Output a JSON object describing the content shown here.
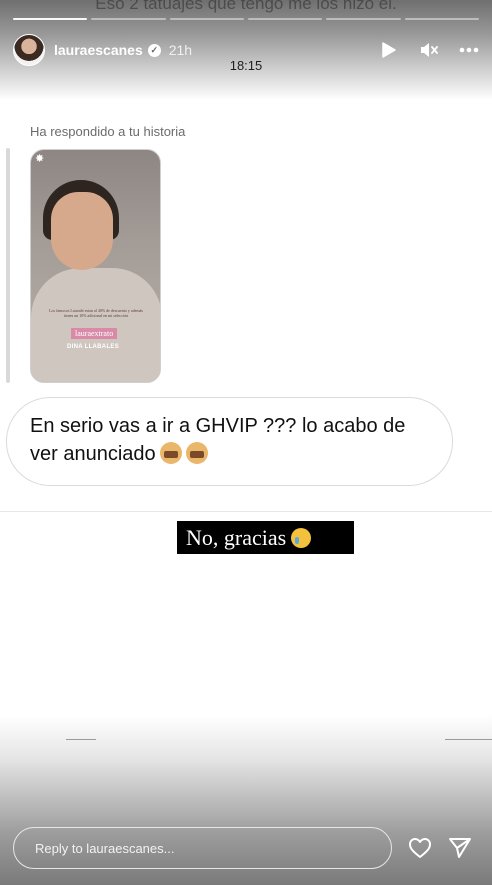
{
  "background": {
    "previous_text": "Eso 2 tatuajes que tengo me los hizo él."
  },
  "progress": {
    "segments": 6,
    "done": 1
  },
  "header": {
    "username": "lauraescanes",
    "time_ago": "21h",
    "verified_icon": "verified-check-icon",
    "clock": "18:15"
  },
  "reply": {
    "label": "Ha respondido a tu historia",
    "thumb_code": "lauraextrato",
    "thumb_brand": "DINA LLABALES",
    "thumb_text": "Los famosos Lauradó estan al 40% de descuento y además tienes un 10% adicional en mi selección",
    "message": "En serio vas a ir a GHVIP ??? lo acabo de ver anunciado"
  },
  "story": {
    "caption": "No, gracias"
  },
  "footer": {
    "reply_placeholder": "Reply to lauraescanes..."
  },
  "icons": {
    "play": "play-icon",
    "mute": "mute-icon",
    "more": "more-icon",
    "heart": "heart-icon",
    "send": "send-icon"
  }
}
